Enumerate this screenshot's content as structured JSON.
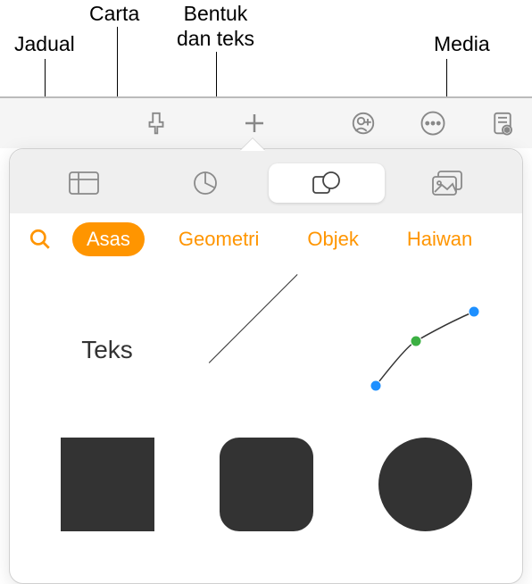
{
  "callouts": {
    "jadual": "Jadual",
    "carta": "Carta",
    "bentuk": "Bentuk\ndan teks",
    "media": "Media"
  },
  "segments": {
    "table": "table",
    "chart": "chart",
    "shape": "shape",
    "media": "media"
  },
  "categories": {
    "asas": "Asas",
    "geometri": "Geometri",
    "objek": "Objek",
    "haiwan": "Haiwan"
  },
  "shapes": {
    "text_label": "Teks"
  }
}
